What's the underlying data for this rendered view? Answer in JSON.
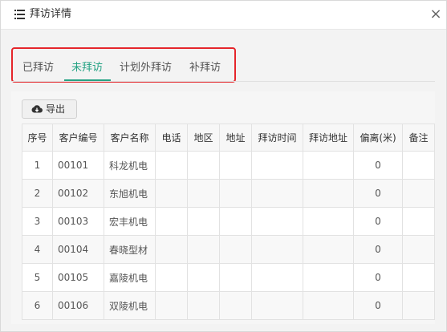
{
  "dialog": {
    "title": "拜访详情",
    "close_symbol": "×"
  },
  "tabs": [
    {
      "label": "已拜访",
      "active": false
    },
    {
      "label": "未拜访",
      "active": true
    },
    {
      "label": "计划外拜访",
      "active": false
    },
    {
      "label": "补拜访",
      "active": false
    }
  ],
  "toolbar": {
    "export_label": "导出"
  },
  "table": {
    "headers": [
      "序号",
      "客户编号",
      "客户名称",
      "电话",
      "地区",
      "地址",
      "拜访时间",
      "拜访地址",
      "偏离(米)",
      "备注"
    ],
    "rows": [
      [
        "1",
        "00101",
        "科龙机电",
        "",
        "",
        "",
        "",
        "",
        "0",
        ""
      ],
      [
        "2",
        "00102",
        "东旭机电",
        "",
        "",
        "",
        "",
        "",
        "0",
        ""
      ],
      [
        "3",
        "00103",
        "宏丰机电",
        "",
        "",
        "",
        "",
        "",
        "0",
        ""
      ],
      [
        "4",
        "00104",
        "春晓型材",
        "",
        "",
        "",
        "",
        "",
        "0",
        ""
      ],
      [
        "5",
        "00105",
        "嘉陵机电",
        "",
        "",
        "",
        "",
        "",
        "0",
        ""
      ],
      [
        "6",
        "00106",
        "双陵机电",
        "",
        "",
        "",
        "",
        "",
        "0",
        ""
      ]
    ]
  },
  "colors": {
    "accent": "#27a385",
    "highlight_frame": "#e5262b"
  }
}
